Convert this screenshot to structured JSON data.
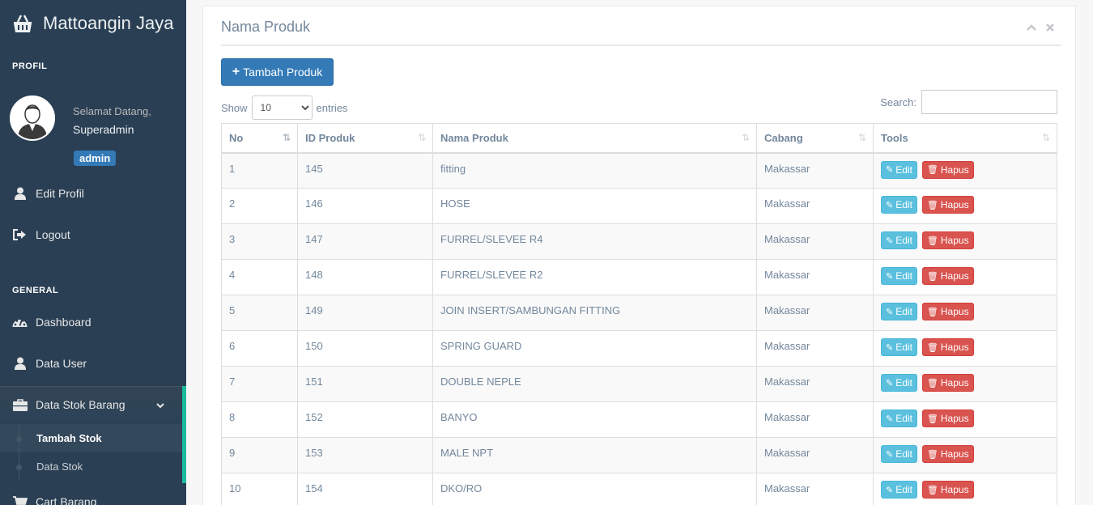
{
  "app": {
    "title": "Mattoangin Jaya"
  },
  "sidebar": {
    "profile_section": "PROFIL",
    "welcome": "Selamat Datang,",
    "username": "Superadmin",
    "role": "admin",
    "profile_items": [
      {
        "label": "Edit Profil",
        "icon": "user-icon"
      },
      {
        "label": "Logout",
        "icon": "sign-out-icon"
      }
    ],
    "general_section": "GENERAL",
    "general_items": [
      {
        "label": "Dashboard",
        "icon": "dashboard-icon"
      },
      {
        "label": "Data User",
        "icon": "user-icon"
      },
      {
        "label": "Data Stok Barang",
        "icon": "briefcase-icon"
      },
      {
        "label": "Cart Barang",
        "icon": "cart-icon"
      }
    ],
    "stok_children": [
      "Tambah Stok",
      "Data Stok"
    ]
  },
  "panel": {
    "title": "Nama Produk",
    "add_button": "Tambah Produk",
    "show_label": "Show",
    "entries_label": "entries",
    "page_size": "10",
    "search_label": "Search:",
    "search_value": "",
    "columns": [
      "No",
      "ID Produk",
      "Nama Produk",
      "Cabang",
      "Tools"
    ],
    "edit_label": "Edit",
    "delete_label": "Hapus",
    "rows": [
      {
        "no": "1",
        "id": "145",
        "nama": "fitting",
        "cabang": "Makassar"
      },
      {
        "no": "2",
        "id": "146",
        "nama": "HOSE",
        "cabang": "Makassar"
      },
      {
        "no": "3",
        "id": "147",
        "nama": "FURREL/SLEVEE R4",
        "cabang": "Makassar"
      },
      {
        "no": "4",
        "id": "148",
        "nama": "FURREL/SLEVEE R2",
        "cabang": "Makassar"
      },
      {
        "no": "5",
        "id": "149",
        "nama": "JOIN INSERT/SAMBUNGAN FITTING",
        "cabang": "Makassar"
      },
      {
        "no": "6",
        "id": "150",
        "nama": "SPRING GUARD",
        "cabang": "Makassar"
      },
      {
        "no": "7",
        "id": "151",
        "nama": "DOUBLE NEPLE",
        "cabang": "Makassar"
      },
      {
        "no": "8",
        "id": "152",
        "nama": "BANYO",
        "cabang": "Makassar"
      },
      {
        "no": "9",
        "id": "153",
        "nama": "MALE NPT",
        "cabang": "Makassar"
      },
      {
        "no": "10",
        "id": "154",
        "nama": "DKO/RO",
        "cabang": "Makassar"
      }
    ]
  },
  "colors": {
    "sidebar": "#2A3F54",
    "accent": "#1ABB9C",
    "primary": "#337AB7",
    "info": "#5BC0DE",
    "danger": "#D9534F"
  }
}
